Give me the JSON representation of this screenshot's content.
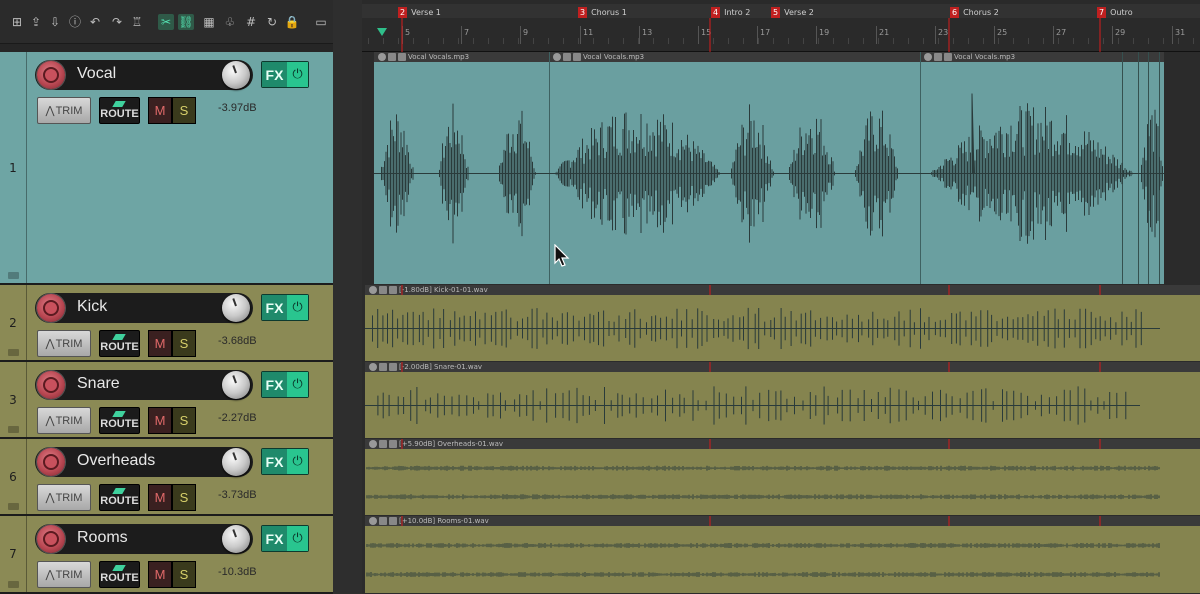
{
  "toolbar": {
    "buttons": [
      {
        "name": "new-project-icon",
        "glyph": "⊞"
      },
      {
        "name": "open-project-icon",
        "glyph": "⇪"
      },
      {
        "name": "save-project-icon",
        "glyph": "⇩"
      },
      {
        "name": "project-info-icon",
        "glyph": "ⓘ"
      },
      {
        "name": "undo-icon",
        "glyph": "↶"
      },
      {
        "name": "redo-icon",
        "glyph": "↷"
      },
      {
        "name": "metronome-icon",
        "glyph": "♖"
      },
      {
        "name": "ripple-edit-icon",
        "glyph": "✂"
      },
      {
        "name": "item-grouping-icon",
        "glyph": "⛓"
      },
      {
        "name": "snap-grid-icon",
        "glyph": "▦"
      },
      {
        "name": "envelope-lock-icon",
        "glyph": "♧"
      },
      {
        "name": "grid-lines-icon",
        "glyph": "#"
      },
      {
        "name": "loop-icon",
        "glyph": "↻"
      },
      {
        "name": "lock-icon",
        "glyph": "🔒"
      },
      {
        "name": "view-toggle-icon",
        "glyph": "▭"
      },
      {
        "name": "pencil-edit-icon",
        "glyph": "✎"
      }
    ]
  },
  "tracks": [
    {
      "number": "1",
      "name": "Vocal",
      "volume": "-3.97dB",
      "color": "#6ea5a4",
      "fx_label": "FX",
      "trim_label": "TRIM",
      "route_label": "ROUTE",
      "mute_label": "M",
      "solo_label": "S"
    },
    {
      "number": "2",
      "name": "Kick",
      "volume": "-3.68dB",
      "color": "#8b8a55",
      "fx_label": "FX",
      "trim_label": "TRIM",
      "route_label": "ROUTE",
      "mute_label": "M",
      "solo_label": "S"
    },
    {
      "number": "3",
      "name": "Snare",
      "volume": "-2.27dB",
      "color": "#8b8a55",
      "fx_label": "FX",
      "trim_label": "TRIM",
      "route_label": "ROUTE",
      "mute_label": "M",
      "solo_label": "S"
    },
    {
      "number": "6",
      "name": "Overheads",
      "volume": "-3.73dB",
      "color": "#8b8a55",
      "fx_label": "FX",
      "trim_label": "TRIM",
      "route_label": "ROUTE",
      "mute_label": "M",
      "solo_label": "S"
    },
    {
      "number": "7",
      "name": "Rooms",
      "volume": "-10.3dB",
      "color": "#8b8a55",
      "fx_label": "FX",
      "trim_label": "TRIM",
      "route_label": "ROUTE",
      "mute_label": "M",
      "solo_label": "S"
    }
  ],
  "markers": [
    {
      "num": "2",
      "label": "Verse 1"
    },
    {
      "num": "3",
      "label": "Chorus 1"
    },
    {
      "num": "4",
      "label": "Intro 2"
    },
    {
      "num": "5",
      "label": "Verse 2"
    },
    {
      "num": "6",
      "label": "Chorus 2"
    },
    {
      "num": "7",
      "label": "Outro"
    }
  ],
  "ruler_bars": [
    "5",
    "7",
    "9",
    "11",
    "13",
    "15",
    "17",
    "19",
    "21",
    "23",
    "25",
    "27",
    "29",
    "31"
  ],
  "items": {
    "vocal": [
      "Vocal Vocals.mp3",
      "Vocal Vocals.mp3",
      "Vocal Vocals.mp3"
    ],
    "kick": "[-1.80dB] Kick-01-01.wav",
    "snare": "[-2.00dB] Snare-01.wav",
    "overheads": "[+5.90dB] Overheads-01.wav",
    "rooms": "[+10.0dB] Rooms-01.wav"
  },
  "colors": {
    "vocal_item_bg": "#6a9fa0",
    "drum_item_bg": "#85844f",
    "waveform": "#2a3b3b",
    "marker_red": "#c02020",
    "fx_green": "#29c58f"
  }
}
